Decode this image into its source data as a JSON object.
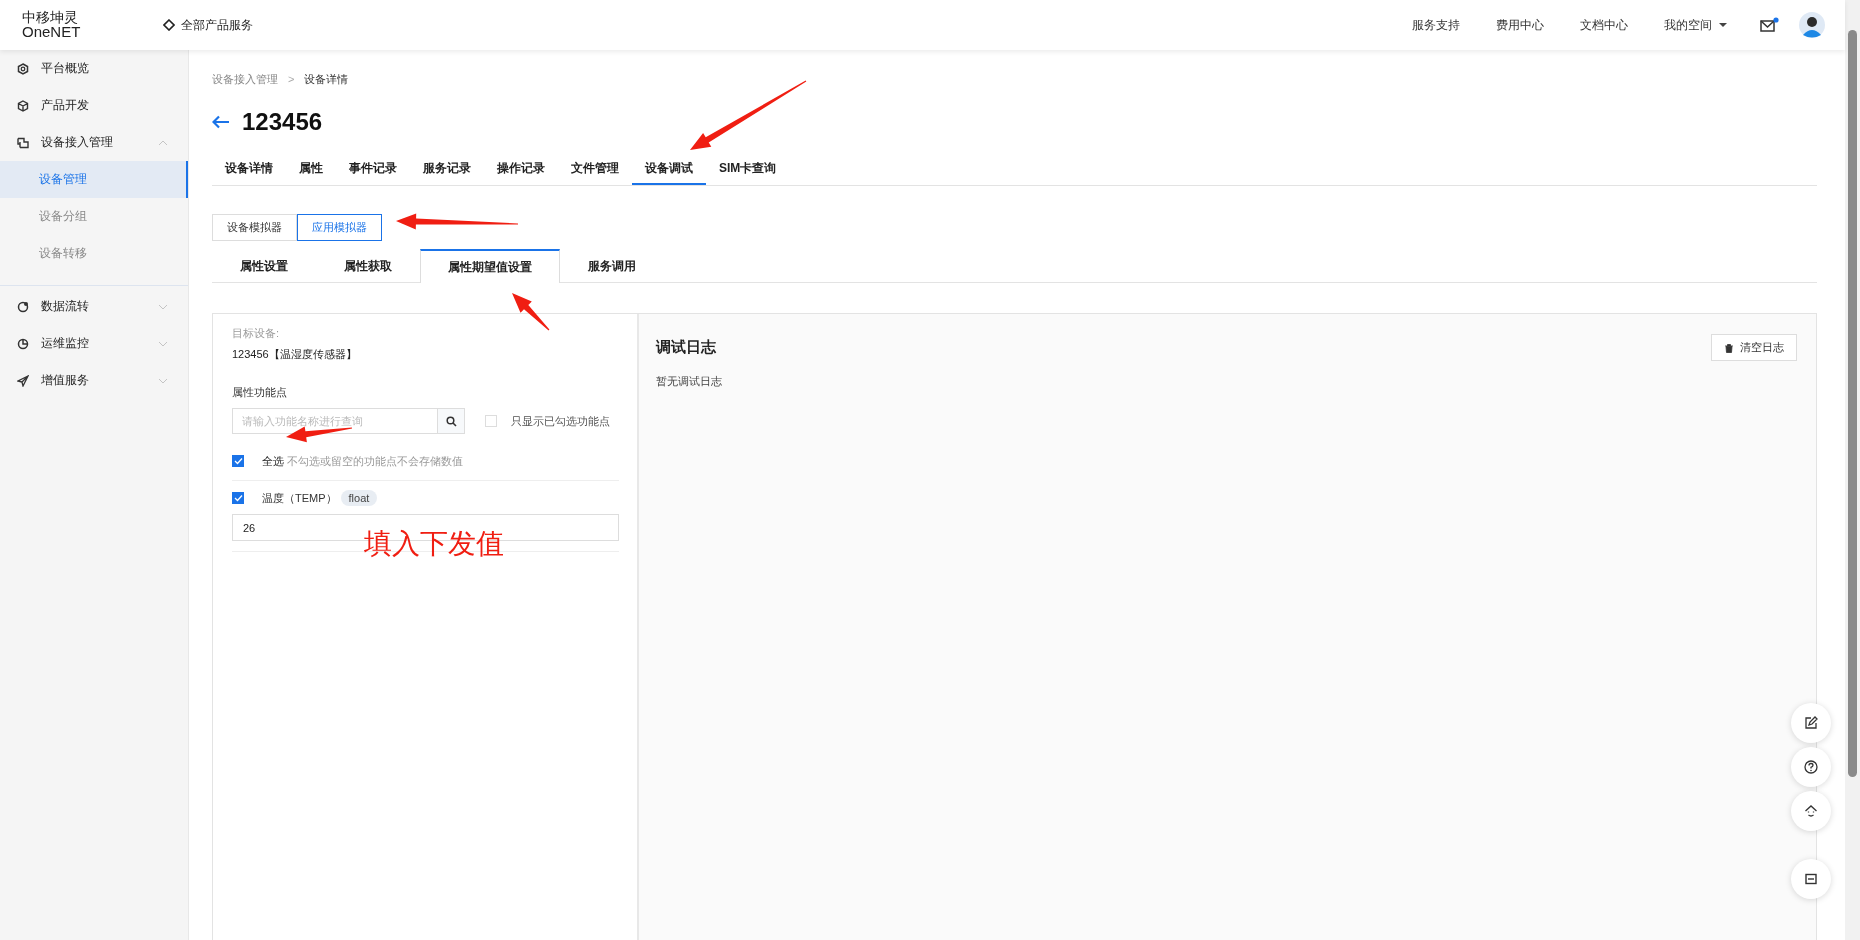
{
  "header": {
    "logo_top": "中移坤灵",
    "logo_bottom": "OneNET",
    "all_products": "全部产品服务",
    "nav": [
      "服务支持",
      "费用中心",
      "文档中心"
    ],
    "my_space": "我的空间",
    "mail_unread": true
  },
  "sidebar": {
    "items": [
      {
        "label": "平台概览"
      },
      {
        "label": "产品开发"
      },
      {
        "label": "设备接入管理",
        "expanded": true,
        "children": [
          {
            "label": "设备管理",
            "selected": true
          },
          {
            "label": "设备分组",
            "selected": false
          },
          {
            "label": "设备转移",
            "selected": false
          }
        ]
      },
      {
        "label": "数据流转",
        "expanded": false
      },
      {
        "label": "运维监控",
        "expanded": false
      },
      {
        "label": "增值服务",
        "expanded": false
      }
    ]
  },
  "breadcrumb": [
    "设备接入管理",
    "设备详情"
  ],
  "breadcrumb_separator": ">",
  "title": "123456",
  "tabs": [
    {
      "label": "设备详情",
      "selected": false
    },
    {
      "label": "属性",
      "selected": false
    },
    {
      "label": "事件记录",
      "selected": false
    },
    {
      "label": "服务记录",
      "selected": false
    },
    {
      "label": "操作记录",
      "selected": false
    },
    {
      "label": "文件管理",
      "selected": false
    },
    {
      "label": "设备调试",
      "selected": true
    },
    {
      "label": "SIM卡查询",
      "selected": false
    }
  ],
  "mode_buttons": [
    {
      "label": "设备模拟器",
      "selected": false
    },
    {
      "label": "应用模拟器",
      "selected": true
    }
  ],
  "sub_tabs": [
    {
      "label": "属性设置",
      "selected": false
    },
    {
      "label": "属性获取",
      "selected": false
    },
    {
      "label": "属性期望值设置",
      "selected": true
    },
    {
      "label": "服务调用",
      "selected": false
    }
  ],
  "left_panel": {
    "target_label": "目标设备:",
    "target_value": "123456【温湿度传感器】",
    "section_label": "属性功能点",
    "search": {
      "placeholder": "请输入功能名称进行查询"
    },
    "filter": {
      "label": "只显示已勾选功能点",
      "checked": false
    },
    "select_all": {
      "label": "全选",
      "checked": true,
      "hint": "不勾选或留空的功能点不会存储数值"
    },
    "properties": [
      {
        "name": "温度（TEMP）",
        "type": "float",
        "checked": true,
        "value": "26"
      }
    ]
  },
  "right_panel": {
    "title": "调试日志",
    "clear_button": "清空日志",
    "empty_text": "暂无调试日志"
  },
  "annotation": {
    "note": "填入下发值"
  }
}
